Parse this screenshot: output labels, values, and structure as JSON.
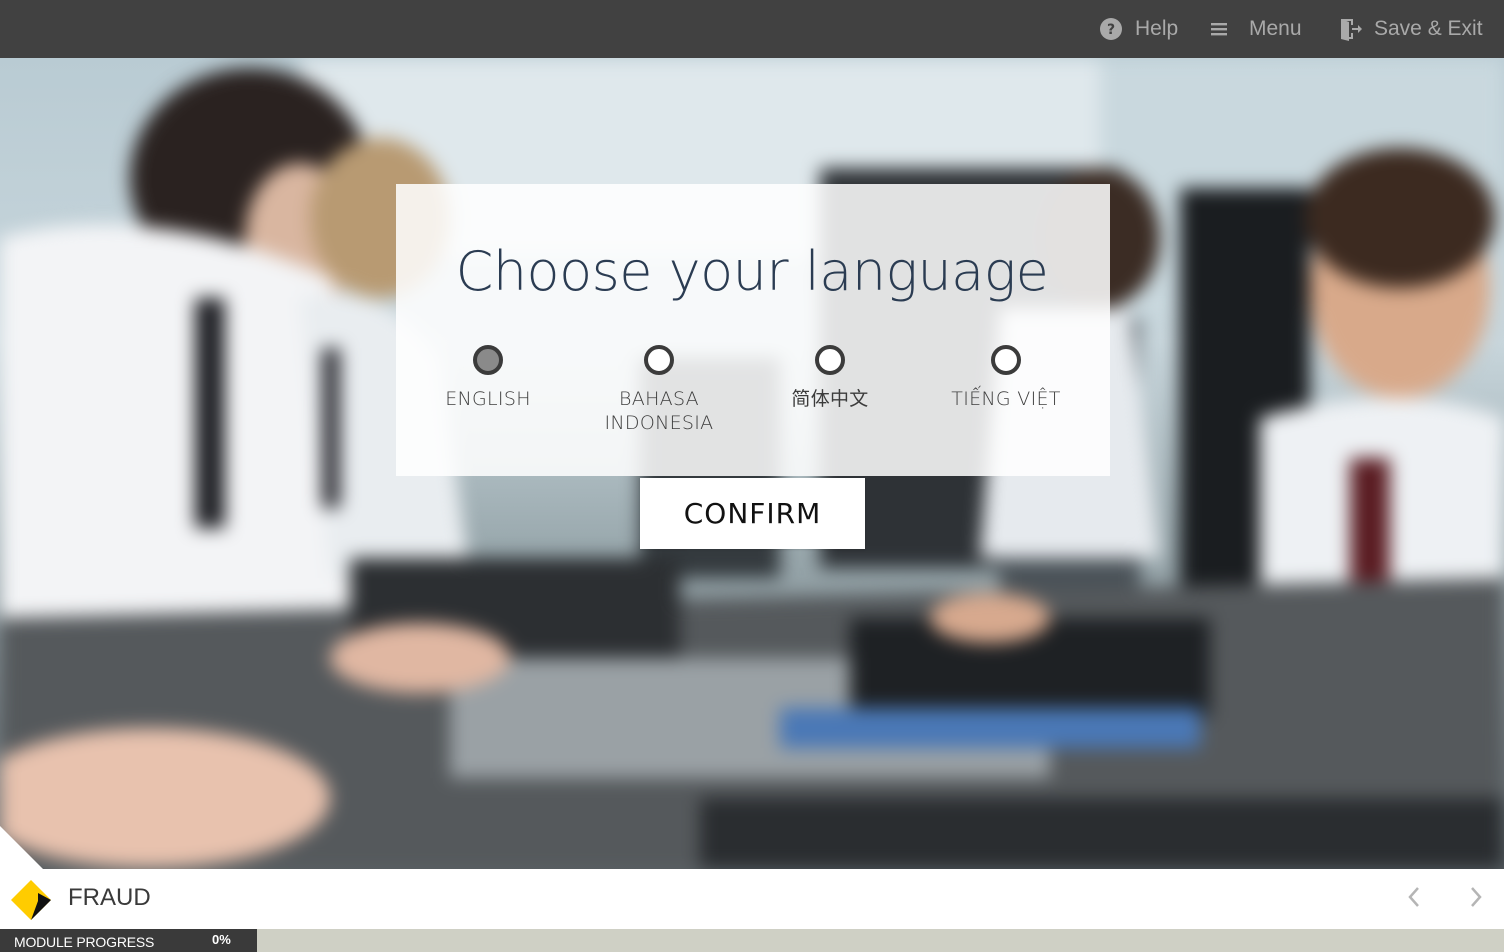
{
  "topbar": {
    "help_label": "Help",
    "help_icon": "question-circle-icon",
    "menu_label": "Menu",
    "menu_icon": "hamburger-icon",
    "save_exit_label": "Save & Exit",
    "save_exit_icon": "exit-door-icon",
    "background_color": "#414141"
  },
  "dialog": {
    "title": "Choose your language",
    "options": [
      {
        "label": "ENGLISH",
        "selected": true
      },
      {
        "label": "BAHASA INDONESIA",
        "selected": false
      },
      {
        "label": "简体中文",
        "selected": false
      },
      {
        "label": "TIẾNG VIỆT",
        "selected": false
      }
    ],
    "confirm_label": "CONFIRM"
  },
  "footer": {
    "module_title": "FRAUD",
    "logo_icon": "yellow-diamond-logo",
    "logo_color": "#ffcc00",
    "prev_icon": "chevron-left-icon",
    "next_icon": "chevron-right-icon"
  },
  "progress": {
    "label": "MODULE PROGRESS",
    "value_text": "0%",
    "value": 0
  }
}
